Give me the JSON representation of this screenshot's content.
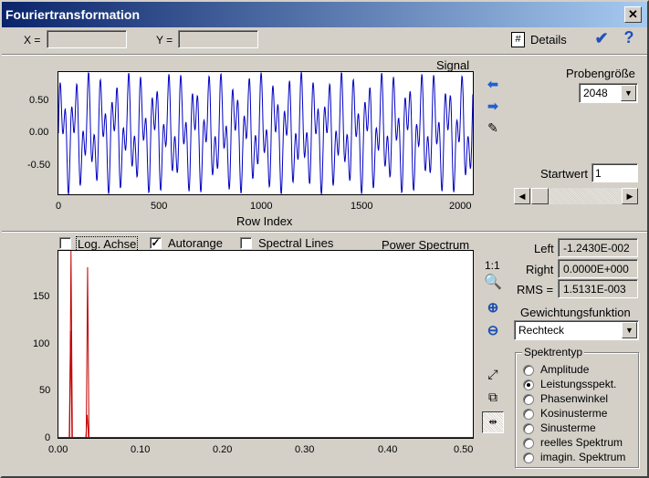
{
  "window": {
    "title": "Fouriertransformation"
  },
  "toolbar": {
    "x_label": "X =",
    "y_label": "Y =",
    "details_label": "Details"
  },
  "signal_panel": {
    "title": "Signal",
    "xlabel": "Row Index",
    "x_ticks": [
      "0",
      "500",
      "1000",
      "1500",
      "2000"
    ],
    "y_ticks": [
      "0.50",
      "0.00",
      "-0.50"
    ]
  },
  "sample_size": {
    "label": "Probengröße",
    "value": "2048"
  },
  "start_value": {
    "label": "Startwert",
    "value": "1"
  },
  "spectrum_panel": {
    "title": "Power Spectrum",
    "log_axis": {
      "label": "Log. Achse",
      "checked": false
    },
    "autorange": {
      "label": "Autorange",
      "checked": true
    },
    "spectral_lines": {
      "label": "Spectral Lines",
      "checked": false
    },
    "x_ticks": [
      "0.00",
      "0.10",
      "0.20",
      "0.30",
      "0.40",
      "0.50"
    ],
    "y_ticks": [
      "150",
      "100",
      "50",
      "0"
    ],
    "zoom_ratio": "1:1"
  },
  "stats": {
    "left_label": "Left",
    "left_value": "-1.2430E-002",
    "right_label": "Right",
    "right_value": "0.0000E+000",
    "rms_label": "RMS =",
    "rms_value": "1.5131E-003"
  },
  "weighting": {
    "label": "Gewichtungsfunktion",
    "value": "Rechteck"
  },
  "spectrum_type": {
    "label": "Spektrentyp",
    "options": [
      "Amplitude",
      "Leistungsspekt.",
      "Phasenwinkel",
      "Kosinusterme",
      "Sinusterme",
      "reelles Spektrum",
      "imagin. Spektrum"
    ],
    "selected_index": 1
  },
  "chart_data": [
    {
      "type": "line",
      "title": "Signal",
      "xlabel": "Row Index",
      "ylabel": "",
      "xlim": [
        0,
        2048
      ],
      "ylim": [
        -0.95,
        0.95
      ],
      "series": [
        {
          "components": [
            {
              "amplitude": 0.5,
              "cycles_per_sample": 0.0152
            },
            {
              "amplitude": 0.45,
              "cycles_per_sample": 0.0352
            }
          ]
        }
      ],
      "color": "#0000c0"
    },
    {
      "type": "line",
      "title": "Power Spectrum",
      "xlabel": "",
      "ylabel": "",
      "xlim": [
        0,
        0.5
      ],
      "ylim": [
        0,
        195
      ],
      "series": [
        {
          "peaks": [
            {
              "x": 0.0152,
              "y": 195
            },
            {
              "x": 0.0147,
              "y": 112
            },
            {
              "x": 0.0352,
              "y": 178
            },
            {
              "x": 0.0347,
              "y": 24
            }
          ]
        }
      ],
      "color": "#c00000"
    }
  ]
}
